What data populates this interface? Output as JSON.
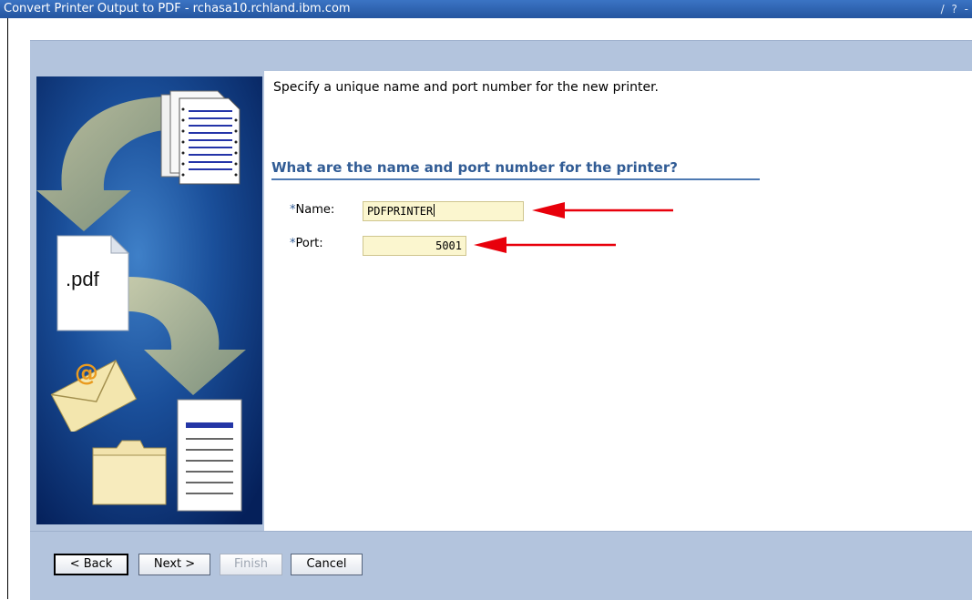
{
  "window": {
    "title": "Convert Printer Output to PDF - rchasa10.rchland.ibm.com",
    "controls": "/ ? -"
  },
  "side_image": {
    "pdf_label": ".pdf",
    "icons": [
      "document-stack-icon",
      "pdf-file-icon",
      "email-envelope-icon",
      "folder-icon",
      "text-document-icon"
    ]
  },
  "main": {
    "instruction": "Specify a unique name and port number for the new printer.",
    "question": "What are the name and port number for the printer?",
    "name_field": {
      "required_marker": "*",
      "label": "Name:",
      "value": "PDFPRINTER"
    },
    "port_field": {
      "required_marker": "*",
      "label": "Port:",
      "value": "5001"
    }
  },
  "buttons": {
    "back": "< Back",
    "next": "Next >",
    "finish": "Finish",
    "cancel": "Cancel"
  },
  "colors": {
    "titlebar": "#2f66b3",
    "frame": "#b3c4dd",
    "field_bg": "#fbf6cf",
    "heading": "#315c95",
    "annotation_arrow": "#e8000b"
  }
}
